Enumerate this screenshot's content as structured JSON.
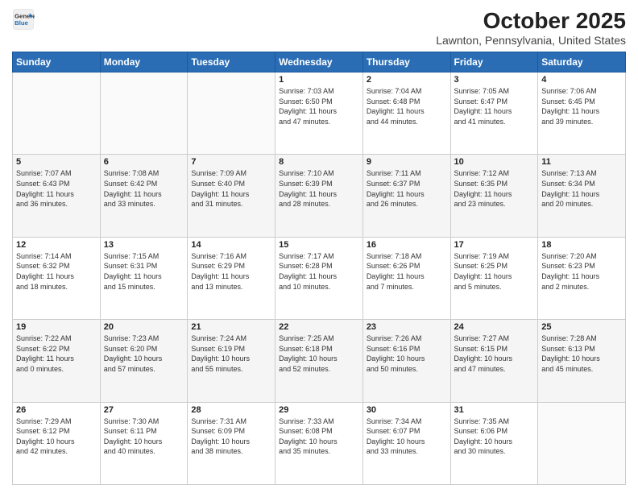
{
  "header": {
    "logo_line1": "General",
    "logo_line2": "Blue",
    "title": "October 2025",
    "subtitle": "Lawnton, Pennsylvania, United States"
  },
  "days_of_week": [
    "Sunday",
    "Monday",
    "Tuesday",
    "Wednesday",
    "Thursday",
    "Friday",
    "Saturday"
  ],
  "weeks": [
    [
      {
        "num": "",
        "info": ""
      },
      {
        "num": "",
        "info": ""
      },
      {
        "num": "",
        "info": ""
      },
      {
        "num": "1",
        "info": "Sunrise: 7:03 AM\nSunset: 6:50 PM\nDaylight: 11 hours\nand 47 minutes."
      },
      {
        "num": "2",
        "info": "Sunrise: 7:04 AM\nSunset: 6:48 PM\nDaylight: 11 hours\nand 44 minutes."
      },
      {
        "num": "3",
        "info": "Sunrise: 7:05 AM\nSunset: 6:47 PM\nDaylight: 11 hours\nand 41 minutes."
      },
      {
        "num": "4",
        "info": "Sunrise: 7:06 AM\nSunset: 6:45 PM\nDaylight: 11 hours\nand 39 minutes."
      }
    ],
    [
      {
        "num": "5",
        "info": "Sunrise: 7:07 AM\nSunset: 6:43 PM\nDaylight: 11 hours\nand 36 minutes."
      },
      {
        "num": "6",
        "info": "Sunrise: 7:08 AM\nSunset: 6:42 PM\nDaylight: 11 hours\nand 33 minutes."
      },
      {
        "num": "7",
        "info": "Sunrise: 7:09 AM\nSunset: 6:40 PM\nDaylight: 11 hours\nand 31 minutes."
      },
      {
        "num": "8",
        "info": "Sunrise: 7:10 AM\nSunset: 6:39 PM\nDaylight: 11 hours\nand 28 minutes."
      },
      {
        "num": "9",
        "info": "Sunrise: 7:11 AM\nSunset: 6:37 PM\nDaylight: 11 hours\nand 26 minutes."
      },
      {
        "num": "10",
        "info": "Sunrise: 7:12 AM\nSunset: 6:35 PM\nDaylight: 11 hours\nand 23 minutes."
      },
      {
        "num": "11",
        "info": "Sunrise: 7:13 AM\nSunset: 6:34 PM\nDaylight: 11 hours\nand 20 minutes."
      }
    ],
    [
      {
        "num": "12",
        "info": "Sunrise: 7:14 AM\nSunset: 6:32 PM\nDaylight: 11 hours\nand 18 minutes."
      },
      {
        "num": "13",
        "info": "Sunrise: 7:15 AM\nSunset: 6:31 PM\nDaylight: 11 hours\nand 15 minutes."
      },
      {
        "num": "14",
        "info": "Sunrise: 7:16 AM\nSunset: 6:29 PM\nDaylight: 11 hours\nand 13 minutes."
      },
      {
        "num": "15",
        "info": "Sunrise: 7:17 AM\nSunset: 6:28 PM\nDaylight: 11 hours\nand 10 minutes."
      },
      {
        "num": "16",
        "info": "Sunrise: 7:18 AM\nSunset: 6:26 PM\nDaylight: 11 hours\nand 7 minutes."
      },
      {
        "num": "17",
        "info": "Sunrise: 7:19 AM\nSunset: 6:25 PM\nDaylight: 11 hours\nand 5 minutes."
      },
      {
        "num": "18",
        "info": "Sunrise: 7:20 AM\nSunset: 6:23 PM\nDaylight: 11 hours\nand 2 minutes."
      }
    ],
    [
      {
        "num": "19",
        "info": "Sunrise: 7:22 AM\nSunset: 6:22 PM\nDaylight: 11 hours\nand 0 minutes."
      },
      {
        "num": "20",
        "info": "Sunrise: 7:23 AM\nSunset: 6:20 PM\nDaylight: 10 hours\nand 57 minutes."
      },
      {
        "num": "21",
        "info": "Sunrise: 7:24 AM\nSunset: 6:19 PM\nDaylight: 10 hours\nand 55 minutes."
      },
      {
        "num": "22",
        "info": "Sunrise: 7:25 AM\nSunset: 6:18 PM\nDaylight: 10 hours\nand 52 minutes."
      },
      {
        "num": "23",
        "info": "Sunrise: 7:26 AM\nSunset: 6:16 PM\nDaylight: 10 hours\nand 50 minutes."
      },
      {
        "num": "24",
        "info": "Sunrise: 7:27 AM\nSunset: 6:15 PM\nDaylight: 10 hours\nand 47 minutes."
      },
      {
        "num": "25",
        "info": "Sunrise: 7:28 AM\nSunset: 6:13 PM\nDaylight: 10 hours\nand 45 minutes."
      }
    ],
    [
      {
        "num": "26",
        "info": "Sunrise: 7:29 AM\nSunset: 6:12 PM\nDaylight: 10 hours\nand 42 minutes."
      },
      {
        "num": "27",
        "info": "Sunrise: 7:30 AM\nSunset: 6:11 PM\nDaylight: 10 hours\nand 40 minutes."
      },
      {
        "num": "28",
        "info": "Sunrise: 7:31 AM\nSunset: 6:09 PM\nDaylight: 10 hours\nand 38 minutes."
      },
      {
        "num": "29",
        "info": "Sunrise: 7:33 AM\nSunset: 6:08 PM\nDaylight: 10 hours\nand 35 minutes."
      },
      {
        "num": "30",
        "info": "Sunrise: 7:34 AM\nSunset: 6:07 PM\nDaylight: 10 hours\nand 33 minutes."
      },
      {
        "num": "31",
        "info": "Sunrise: 7:35 AM\nSunset: 6:06 PM\nDaylight: 10 hours\nand 30 minutes."
      },
      {
        "num": "",
        "info": ""
      }
    ]
  ]
}
